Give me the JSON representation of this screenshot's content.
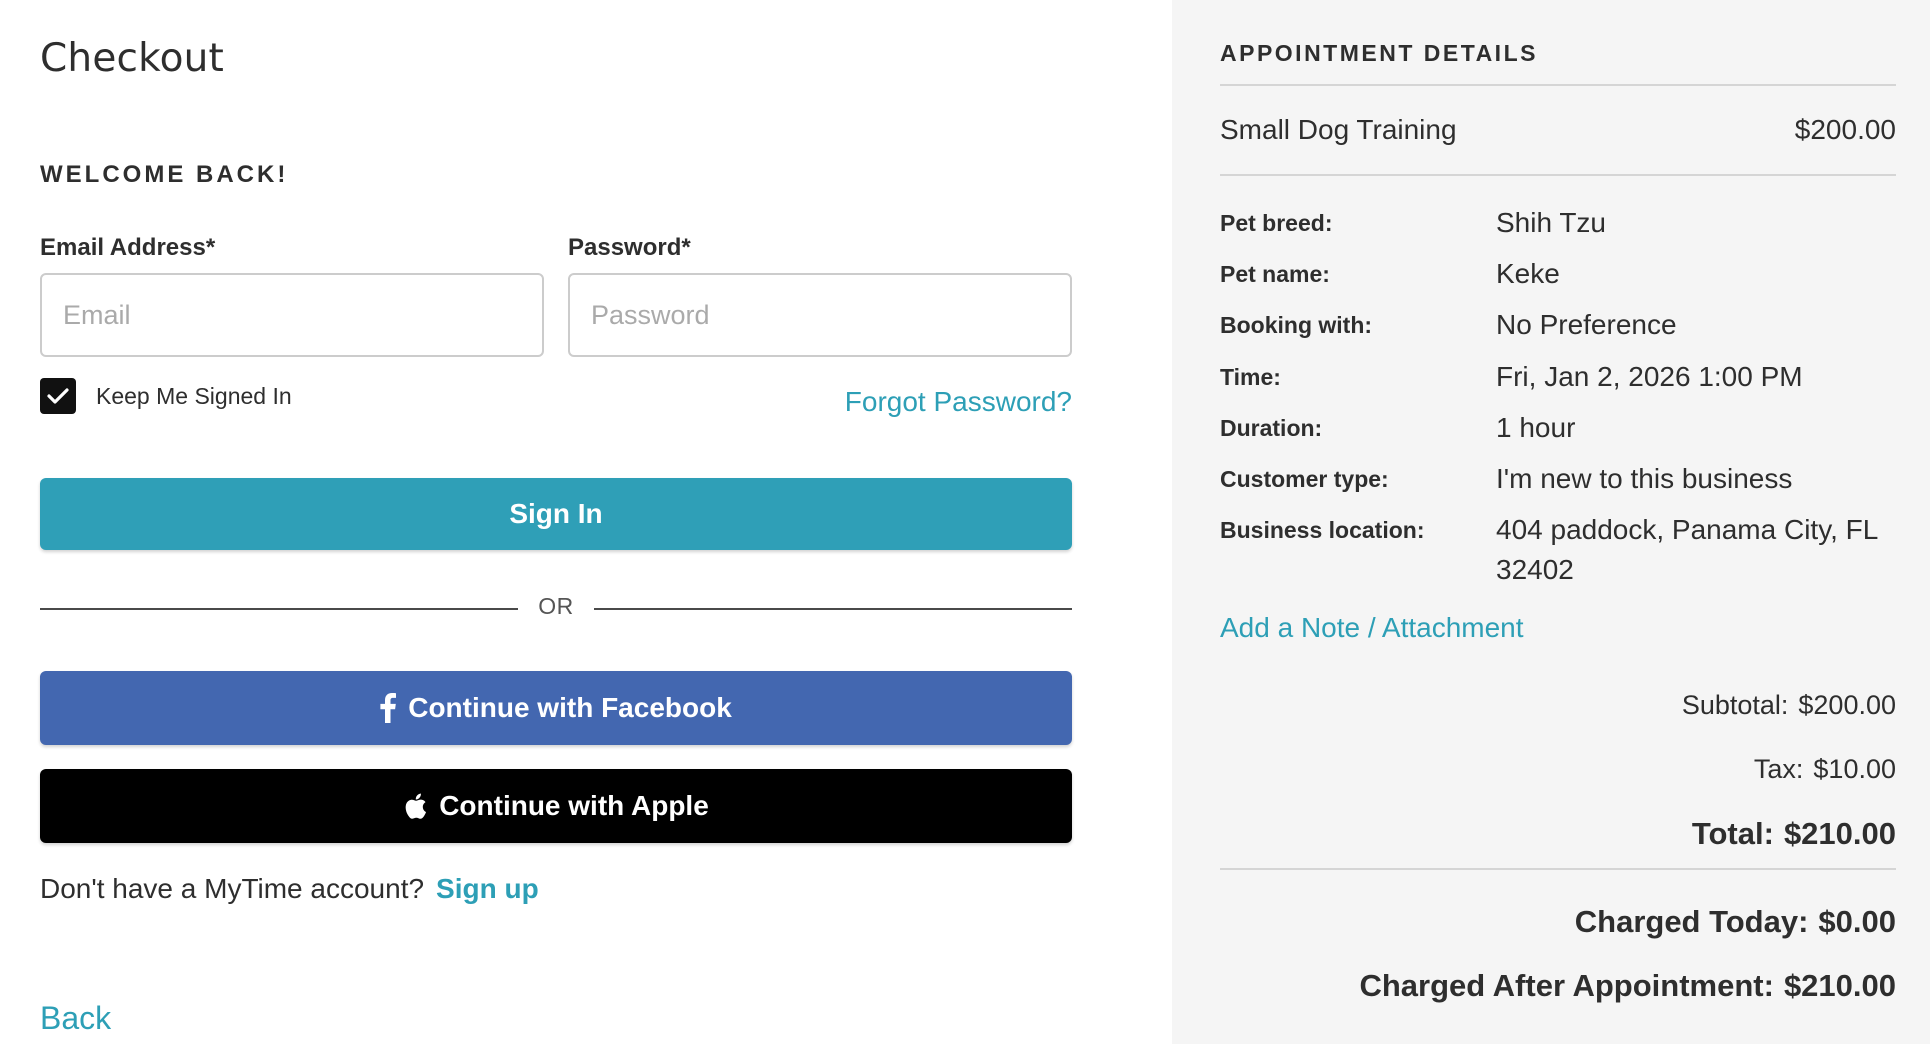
{
  "page": {
    "title": "Checkout"
  },
  "signin": {
    "heading": "WELCOME BACK!",
    "email_label": "Email Address*",
    "email_placeholder": "Email",
    "email_value": "",
    "password_label": "Password*",
    "password_placeholder": "Password",
    "password_value": "",
    "keep_signed_in_label": "Keep Me Signed In",
    "keep_signed_in_checked": true,
    "forgot_password": "Forgot Password?",
    "sign_in_button": "Sign In",
    "divider_text": "OR",
    "facebook_button": "Continue with Facebook",
    "apple_button": "Continue with Apple",
    "no_account_text": "Don't have a MyTime account?",
    "sign_up_link": "Sign up",
    "back_link": "Back"
  },
  "appointment": {
    "section_title": "APPOINTMENT DETAILS",
    "service_name": "Small Dog Training",
    "service_price": "$200.00",
    "details": [
      {
        "label": "Pet breed:",
        "value": "Shih Tzu"
      },
      {
        "label": "Pet name:",
        "value": "Keke"
      },
      {
        "label": "Booking with:",
        "value": "No Preference"
      },
      {
        "label": "Time:",
        "value": "Fri, Jan 2, 2026 1:00 PM"
      },
      {
        "label": "Duration:",
        "value": "1 hour"
      },
      {
        "label": "Customer type:",
        "value": "I'm new to this business"
      },
      {
        "label": "Business location:",
        "value": "404 paddock, Panama City, FL 32402"
      }
    ],
    "add_note_link": "Add a Note / Attachment",
    "subtotal_label": "Subtotal:",
    "subtotal_value": "$200.00",
    "tax_label": "Tax:",
    "tax_value": "$10.00",
    "total_label": "Total:",
    "total_value": "$210.00",
    "charged_today_label": "Charged Today:",
    "charged_today_value": "$0.00",
    "charged_after_label": "Charged After Appointment:",
    "charged_after_value": "$210.00"
  },
  "icons": {
    "checkbox": "checkmark-icon",
    "facebook": "facebook-icon",
    "apple": "apple-icon"
  },
  "colors": {
    "accent_teal": "#2f9fb7",
    "link_teal": "#2d9fb6",
    "facebook_blue": "#4367b0",
    "apple_black": "#000000",
    "sidebar_bg": "#f5f5f5"
  }
}
